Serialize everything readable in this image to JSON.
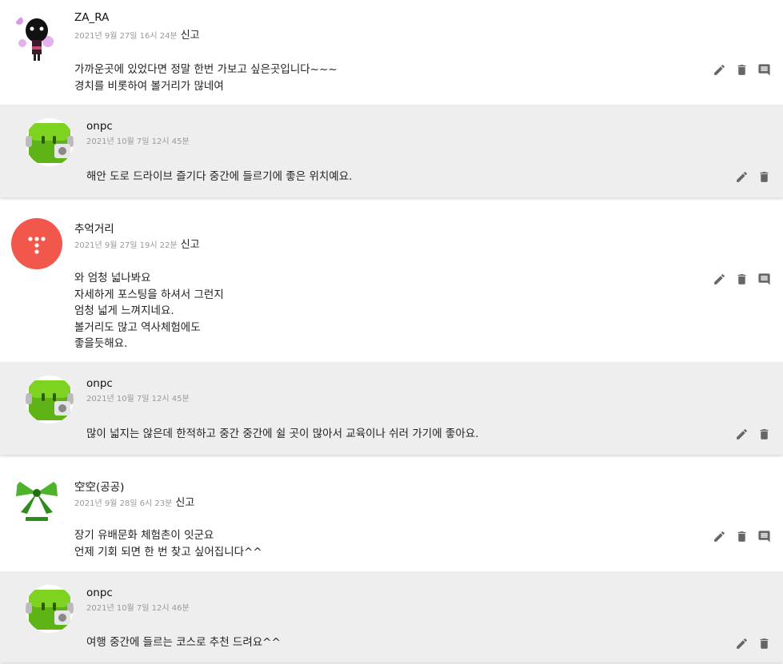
{
  "report_label": "신고",
  "threads": [
    {
      "author": "ZA_RA",
      "date": "2021년 9월 27일 16시 24분",
      "lines": [
        "가까운곳에 있었다면 정말 한번 가보고 싶은곳입니다~~~",
        "경치를 비롯하여 볼거리가 많네여"
      ],
      "reply": {
        "author": "onpc",
        "date": "2021년 10월 7일 12시 45분",
        "lines": [
          "해안 도로 드라이브 즐기다 중간에 들르기에 좋은 위치예요."
        ]
      }
    },
    {
      "author": "추억거리",
      "date": "2021년 9월 27일 19시 22분",
      "lines": [
        "와 엄청 넓나봐요",
        "자세하게 포스팅을 하셔서 그런지",
        "엄청 넓게 느껴지네요.",
        "볼거리도 많고 역사체험에도",
        "좋을듯해요."
      ],
      "reply": {
        "author": "onpc",
        "date": "2021년 10월 7일 12시 45분",
        "lines": [
          "많이 넓지는 않은데 한적하고 중간 중간에 쉴 곳이 많아서 교육이나 쉬러 가기에 좋아요."
        ]
      }
    },
    {
      "author": "空空(공공)",
      "date": "2021년 9월 28일 6시 23분",
      "lines": [
        "장기 유배문화 체험촌이 잇군요",
        "언제 기회 되면 한 번 찾고 싶어집니다^^"
      ],
      "reply": {
        "author": "onpc",
        "date": "2021년 10월 7일 12시 46분",
        "lines": [
          "여행 중간에 들르는 코스로 추천 드려요^^"
        ]
      }
    }
  ],
  "icons": {
    "edit": "pencil-icon",
    "delete": "trash-icon",
    "reply": "comment-icon"
  },
  "colors": {
    "reply_bg": "#eeeeee",
    "icon": "#666666",
    "avatar_red": "#f2574b",
    "avatar_green": "#6cc61d"
  }
}
